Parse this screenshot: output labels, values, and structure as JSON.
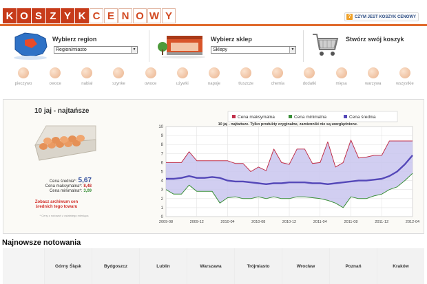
{
  "header": {
    "logo_letters": [
      {
        "char": "K",
        "style": "dark"
      },
      {
        "char": "O",
        "style": "dark"
      },
      {
        "char": "S",
        "style": "dark"
      },
      {
        "char": "Z",
        "style": "dark"
      },
      {
        "char": "Y",
        "style": "dark"
      },
      {
        "char": "K",
        "style": "dark"
      },
      {
        "char": "C",
        "style": "light"
      },
      {
        "char": "E",
        "style": "light"
      },
      {
        "char": "N",
        "style": "light"
      },
      {
        "char": "O",
        "style": "light"
      },
      {
        "char": "W",
        "style": "light"
      },
      {
        "char": "Y",
        "style": "light"
      }
    ],
    "info_link": "CZYM JEST KOSZYK CENOWY",
    "accent_color": "#e06a2c",
    "logo_dark_color": "#c73b1a"
  },
  "selectors": {
    "region": {
      "title": "Wybierz region",
      "value": "Region/miasto",
      "icon": "poland-map-icon"
    },
    "shop": {
      "title": "Wybierz sklep",
      "value": "Sklepy",
      "icon": "store-icon"
    },
    "basket": {
      "title": "Stwórz swój koszyk",
      "icon": "shopping-cart-icon"
    }
  },
  "categories": [
    {
      "label": "pieczywo",
      "icon": "bread-icon"
    },
    {
      "label": "owoce",
      "icon": "fruit-icon"
    },
    {
      "label": "nabiał",
      "icon": "dairy-icon"
    },
    {
      "label": "szynke",
      "icon": "ham-icon"
    },
    {
      "label": "owoce",
      "icon": "fruit-icon"
    },
    {
      "label": "używki",
      "icon": "stimulants-icon"
    },
    {
      "label": "napoje",
      "icon": "drinks-icon"
    },
    {
      "label": "tłuszcze",
      "icon": "fats-icon"
    },
    {
      "label": "chemia",
      "icon": "chemicals-icon"
    },
    {
      "label": "dodatki",
      "icon": "additives-icon"
    },
    {
      "label": "mięsa",
      "icon": "meat-icon"
    },
    {
      "label": "warzywa",
      "icon": "vegetables-icon"
    },
    {
      "label": "wszystkie",
      "icon": "all-icon"
    }
  ],
  "product": {
    "title": "10 jaj - najtańsze",
    "avg_label": "Cena średnia*:",
    "avg_value": "5,67",
    "max_label": "Cena maksymalna*:",
    "max_value": "8,48",
    "min_label": "Cena minimalna*:",
    "min_value": "3,09",
    "archive_link": "Zobacz archiwum cen średnich tego towaru",
    "footnote": "* Ceny z notowań z ostatniego miesiąca"
  },
  "chart_data": {
    "type": "line",
    "title": "",
    "caption": "10 jaj - najtańsze. Tylko produkty oryginalne, zamienniki nie są uwzględnione.",
    "xlabel": "",
    "ylabel": "",
    "ylim": [
      0,
      10
    ],
    "yticks": [
      "0",
      "1",
      "2",
      "3",
      "4",
      "5",
      "6",
      "7",
      "8",
      "9",
      "10"
    ],
    "xticks": [
      "2009-08",
      "2009-12",
      "2010-04",
      "2010-08",
      "2010-12",
      "2011-04",
      "2011-08",
      "2011-12",
      "2012-04"
    ],
    "legend_position": "top",
    "grid": true,
    "x": [
      "2009-08",
      "2009-09",
      "2009-10",
      "2009-11",
      "2009-12",
      "2010-01",
      "2010-02",
      "2010-03",
      "2010-04",
      "2010-05",
      "2010-06",
      "2010-07",
      "2010-08",
      "2010-09",
      "2010-10",
      "2010-11",
      "2010-12",
      "2011-01",
      "2011-02",
      "2011-03",
      "2011-04",
      "2011-05",
      "2011-06",
      "2011-07",
      "2011-08",
      "2011-09",
      "2011-10",
      "2011-11",
      "2011-12",
      "2012-01",
      "2012-02",
      "2012-03",
      "2012-04"
    ],
    "series": [
      {
        "name": "Cena maksymalna",
        "color": "#c0304a",
        "values": [
          6.0,
          6.0,
          6.0,
          7.2,
          6.2,
          6.2,
          6.2,
          6.2,
          6.2,
          5.9,
          5.9,
          5.0,
          5.5,
          5.1,
          7.5,
          6.0,
          5.8,
          7.5,
          7.5,
          5.9,
          6.0,
          8.3,
          5.5,
          6.0,
          8.5,
          6.5,
          6.6,
          6.8,
          6.8,
          8.4,
          8.4,
          8.4,
          8.4
        ]
      },
      {
        "name": "Cena minimalna",
        "color": "#3a8f38",
        "values": [
          3.0,
          2.5,
          2.5,
          3.5,
          2.8,
          2.8,
          2.8,
          1.5,
          2.1,
          2.2,
          2.0,
          2.0,
          2.2,
          2.0,
          2.2,
          2.0,
          2.0,
          2.2,
          2.2,
          2.1,
          2.0,
          1.8,
          1.5,
          1.0,
          2.2,
          2.0,
          2.0,
          2.3,
          2.5,
          3.0,
          3.3,
          4.0,
          4.8
        ]
      },
      {
        "name": "Cena średnia",
        "color": "#5448b8",
        "values": [
          4.2,
          4.2,
          4.3,
          4.5,
          4.3,
          4.3,
          4.4,
          4.3,
          4.0,
          3.9,
          3.9,
          3.8,
          3.7,
          3.6,
          3.7,
          3.7,
          3.8,
          3.8,
          3.8,
          3.7,
          3.7,
          3.6,
          3.7,
          3.8,
          3.9,
          4.0,
          4.0,
          4.1,
          4.2,
          4.5,
          5.0,
          5.8,
          6.8
        ]
      }
    ],
    "fill_color": "#c9c5ef"
  },
  "notowania": {
    "title": "Najnowsze notowania",
    "cities": [
      "Górny Śląsk",
      "Bydgoszcz",
      "Lublin",
      "Warszawa",
      "Trójmiasto",
      "Wrocław",
      "Poznań",
      "Kraków"
    ]
  }
}
